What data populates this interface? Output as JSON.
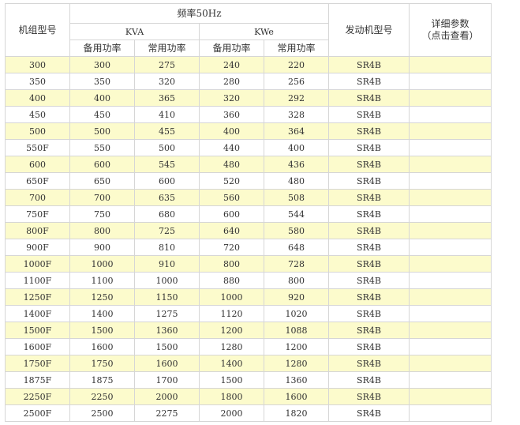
{
  "header": {
    "model": "机组型号",
    "frequency": "频率50Hz",
    "kva": "KVA",
    "kwe": "KWe",
    "standby": "备用功率",
    "prime": "常用功率",
    "engine": "发动机型号",
    "details_line1": "详细参数",
    "details_line2": "（点击查看）"
  },
  "rows": [
    {
      "model": "300",
      "kva_standby": "300",
      "kva_prime": "275",
      "kwe_standby": "240",
      "kwe_prime": "220",
      "engine": "SR4B",
      "details": ""
    },
    {
      "model": "350",
      "kva_standby": "350",
      "kva_prime": "320",
      "kwe_standby": "280",
      "kwe_prime": "256",
      "engine": "SR4B",
      "details": ""
    },
    {
      "model": "400",
      "kva_standby": "400",
      "kva_prime": "365",
      "kwe_standby": "320",
      "kwe_prime": "292",
      "engine": "SR4B",
      "details": ""
    },
    {
      "model": "450",
      "kva_standby": "450",
      "kva_prime": "410",
      "kwe_standby": "360",
      "kwe_prime": "328",
      "engine": "SR4B",
      "details": ""
    },
    {
      "model": "500",
      "kva_standby": "500",
      "kva_prime": "455",
      "kwe_standby": "400",
      "kwe_prime": "364",
      "engine": "SR4B",
      "details": ""
    },
    {
      "model": "550F",
      "kva_standby": "550",
      "kva_prime": "500",
      "kwe_standby": "440",
      "kwe_prime": "400",
      "engine": "SR4B",
      "details": ""
    },
    {
      "model": "600",
      "kva_standby": "600",
      "kva_prime": "545",
      "kwe_standby": "480",
      "kwe_prime": "436",
      "engine": "SR4B",
      "details": ""
    },
    {
      "model": "650F",
      "kva_standby": "650",
      "kva_prime": "600",
      "kwe_standby": "520",
      "kwe_prime": "480",
      "engine": "SR4B",
      "details": ""
    },
    {
      "model": "700",
      "kva_standby": "700",
      "kva_prime": "635",
      "kwe_standby": "560",
      "kwe_prime": "508",
      "engine": "SR4B",
      "details": ""
    },
    {
      "model": "750F",
      "kva_standby": "750",
      "kva_prime": "680",
      "kwe_standby": "600",
      "kwe_prime": "544",
      "engine": "SR4B",
      "details": ""
    },
    {
      "model": "800F",
      "kva_standby": "800",
      "kva_prime": "725",
      "kwe_standby": "640",
      "kwe_prime": "580",
      "engine": "SR4B",
      "details": ""
    },
    {
      "model": "900F",
      "kva_standby": "900",
      "kva_prime": "810",
      "kwe_standby": "720",
      "kwe_prime": "648",
      "engine": "SR4B",
      "details": ""
    },
    {
      "model": "1000F",
      "kva_standby": "1000",
      "kva_prime": "910",
      "kwe_standby": "800",
      "kwe_prime": "728",
      "engine": "SR4B",
      "details": ""
    },
    {
      "model": "1100F",
      "kva_standby": "1100",
      "kva_prime": "1000",
      "kwe_standby": "880",
      "kwe_prime": "800",
      "engine": "SR4B",
      "details": ""
    },
    {
      "model": "1250F",
      "kva_standby": "1250",
      "kva_prime": "1150",
      "kwe_standby": "1000",
      "kwe_prime": "920",
      "engine": "SR4B",
      "details": ""
    },
    {
      "model": "1400F",
      "kva_standby": "1400",
      "kva_prime": "1275",
      "kwe_standby": "1120",
      "kwe_prime": "1020",
      "engine": "SR4B",
      "details": ""
    },
    {
      "model": "1500F",
      "kva_standby": "1500",
      "kva_prime": "1360",
      "kwe_standby": "1200",
      "kwe_prime": "1088",
      "engine": "SR4B",
      "details": ""
    },
    {
      "model": "1600F",
      "kva_standby": "1600",
      "kva_prime": "1500",
      "kwe_standby": "1280",
      "kwe_prime": "1200",
      "engine": "SR4B",
      "details": ""
    },
    {
      "model": "1750F",
      "kva_standby": "1750",
      "kva_prime": "1600",
      "kwe_standby": "1400",
      "kwe_prime": "1280",
      "engine": "SR4B",
      "details": ""
    },
    {
      "model": "1875F",
      "kva_standby": "1875",
      "kva_prime": "1700",
      "kwe_standby": "1500",
      "kwe_prime": "1360",
      "engine": "SR4B",
      "details": ""
    },
    {
      "model": "2250F",
      "kva_standby": "2250",
      "kva_prime": "2000",
      "kwe_standby": "1800",
      "kwe_prime": "1600",
      "engine": "SR4B",
      "details": ""
    },
    {
      "model": "2500F",
      "kva_standby": "2500",
      "kva_prime": "2275",
      "kwe_standby": "2000",
      "kwe_prime": "1820",
      "engine": "SR4B",
      "details": ""
    }
  ],
  "colors": {
    "stripe": "#fcfbcc",
    "border": "#d6d6d6",
    "text": "#333333"
  }
}
